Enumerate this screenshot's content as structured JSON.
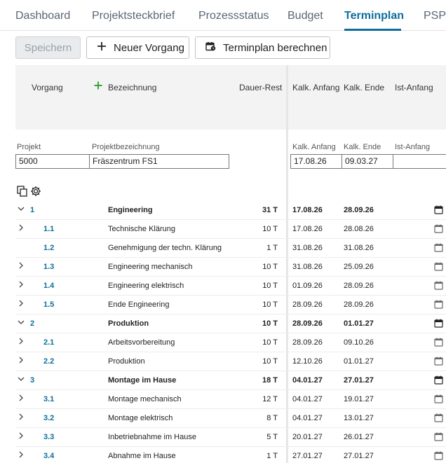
{
  "tabs": [
    {
      "label": "Dashboard"
    },
    {
      "label": "Projektsteckbrief"
    },
    {
      "label": "Prozessstatus"
    },
    {
      "label": "Budget"
    },
    {
      "label": "Terminplan"
    },
    {
      "label": "PSP"
    }
  ],
  "active_tab": "Terminplan",
  "toolbar": {
    "save_label": "Speichern",
    "new_label": "Neuer Vorgang",
    "calc_label": "Terminplan berechnen"
  },
  "columns": {
    "vorgang": "Vorgang",
    "bezeichnung": "Bezeichnung",
    "dauer": "Dauer-Rest",
    "kalk_anfang": "Kalk. Anfang",
    "kalk_ende": "Kalk. Ende",
    "ist_anfang": "Ist-Anfang"
  },
  "project": {
    "projekt_label": "Projekt",
    "bezeichnung_label": "Projektbezeichnung",
    "kalk_anfang_label": "Kalk. Anfang",
    "kalk_ende_label": "Kalk. Ende",
    "ist_anfang_label": "Ist-Anfang",
    "projekt": "5000",
    "bezeichnung": "Fräszentrum FS1",
    "kalk_anfang": "17.08.26",
    "kalk_ende": "09.03.27",
    "ist_anfang": ""
  },
  "rows": [
    {
      "num": "1",
      "name": "Engineering",
      "dur": "31 T",
      "ka": "17.08.26",
      "ke": "28.09.26"
    },
    {
      "num": "1.1",
      "name": "Technische Klärung",
      "dur": "10 T",
      "ka": "17.08.26",
      "ke": "28.08.26"
    },
    {
      "num": "1.2",
      "name": "Genehmigung der techn. Klärung",
      "dur": "1 T",
      "ka": "31.08.26",
      "ke": "31.08.26"
    },
    {
      "num": "1.3",
      "name": "Engineering mechanisch",
      "dur": "10 T",
      "ka": "31.08.26",
      "ke": "25.09.26"
    },
    {
      "num": "1.4",
      "name": "Engineering elektrisch",
      "dur": "10 T",
      "ka": "01.09.26",
      "ke": "28.09.26"
    },
    {
      "num": "1.5",
      "name": "Ende Engineering",
      "dur": "10 T",
      "ka": "28.09.26",
      "ke": "28.09.26"
    },
    {
      "num": "2",
      "name": "Produktion",
      "dur": "10 T",
      "ka": "28.09.26",
      "ke": "01.01.27"
    },
    {
      "num": "2.1",
      "name": "Arbeitsvorbereitung",
      "dur": "10 T",
      "ka": "28.09.26",
      "ke": "09.10.26"
    },
    {
      "num": "2.2",
      "name": "Produktion",
      "dur": "10 T",
      "ka": "12.10.26",
      "ke": "01.01.27"
    },
    {
      "num": "3",
      "name": "Montage im Hause",
      "dur": "18 T",
      "ka": "04.01.27",
      "ke": "27.01.27"
    },
    {
      "num": "3.1",
      "name": "Montage mechanisch",
      "dur": "12 T",
      "ka": "04.01.27",
      "ke": "19.01.27"
    },
    {
      "num": "3.2",
      "name": "Montage elektrisch",
      "dur": "8 T",
      "ka": "04.01.27",
      "ke": "13.01.27"
    },
    {
      "num": "3.3",
      "name": "Inbetriebnahme im Hause",
      "dur": "5 T",
      "ka": "20.01.27",
      "ke": "26.01.27"
    },
    {
      "num": "3.4",
      "name": "Abnahme im Hause",
      "dur": "1 T",
      "ka": "27.01.27",
      "ke": "27.01.27"
    }
  ]
}
